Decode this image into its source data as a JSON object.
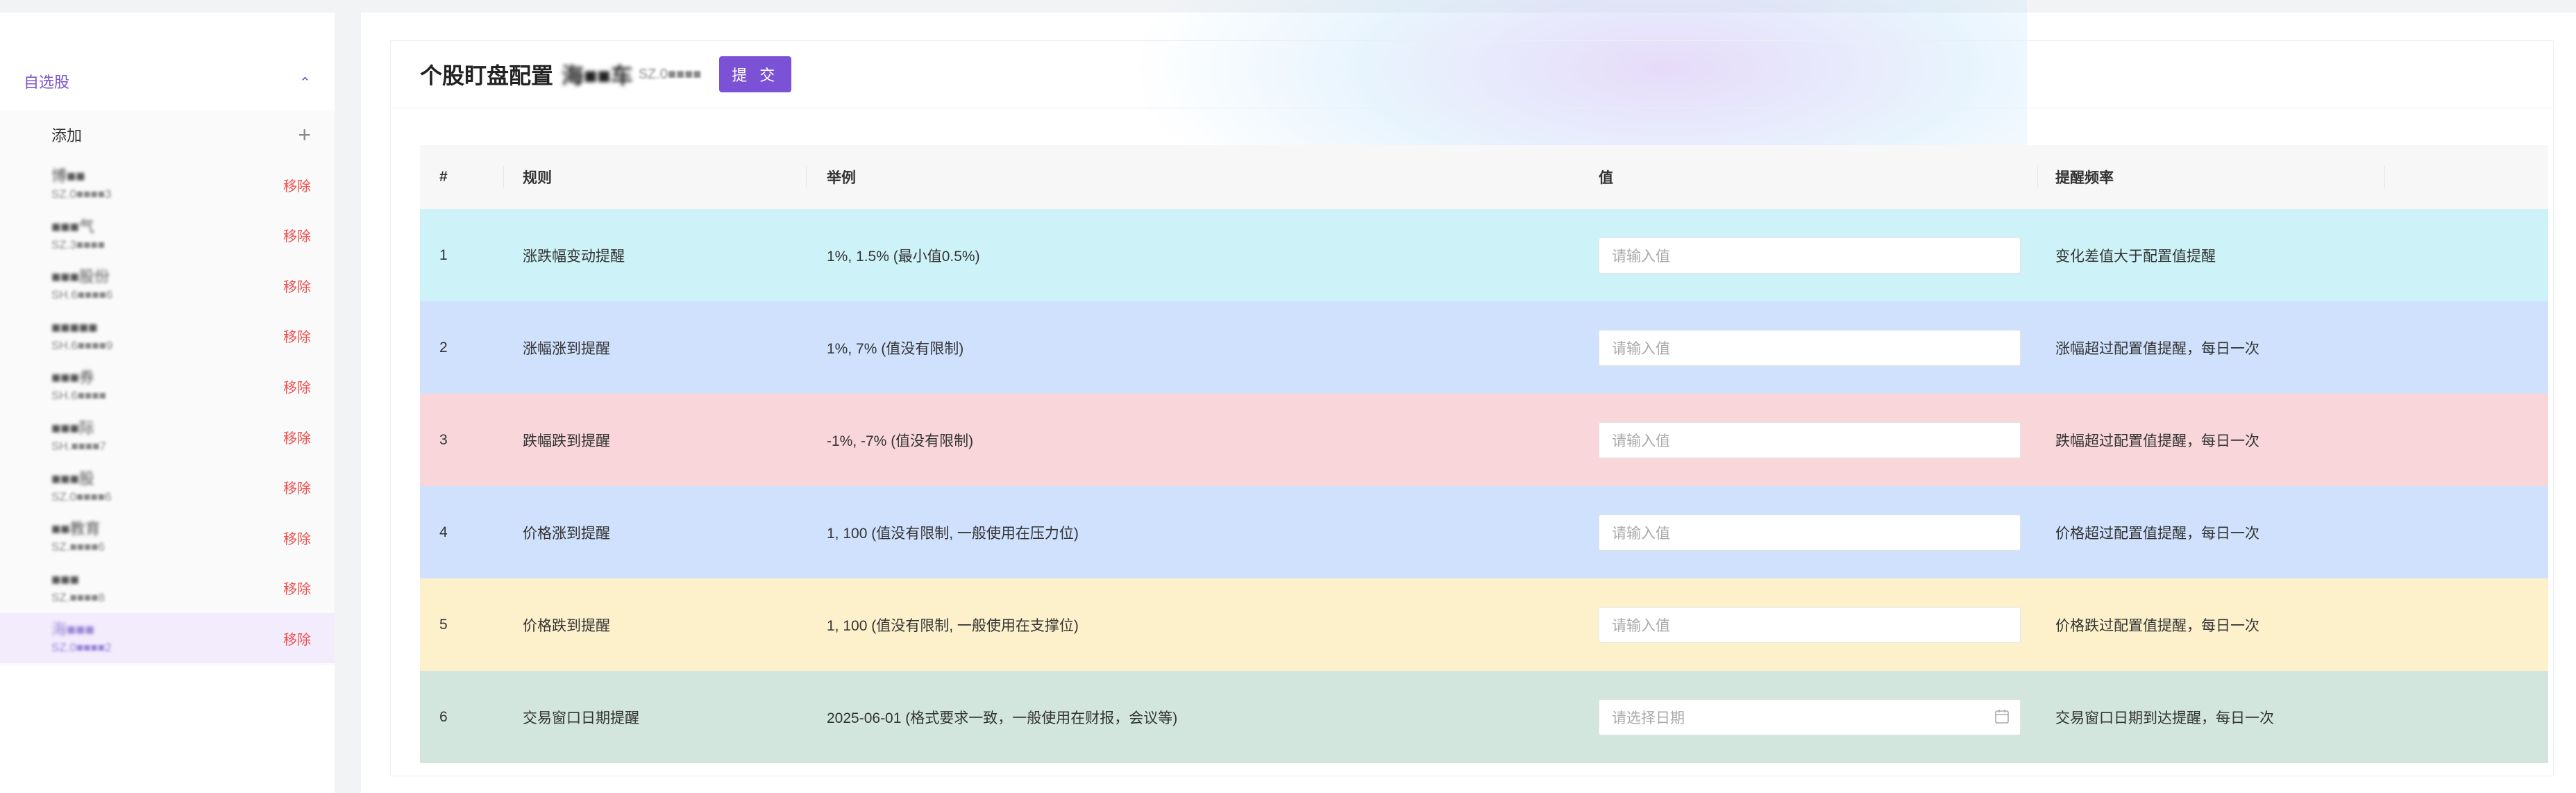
{
  "sidebar": {
    "group_title": "自选股",
    "add_label": "添加",
    "remove_label": "移除",
    "stocks": [
      {
        "name": "博■■",
        "code": "SZ.0■■■■3"
      },
      {
        "name": "■■■气",
        "code": "SZ.3■■■■"
      },
      {
        "name": "■■■股份",
        "code": "SH.6■■■■6"
      },
      {
        "name": "■■■■■",
        "code": "SH.6■■■■9"
      },
      {
        "name": "■■■券",
        "code": "SH.6■■■■"
      },
      {
        "name": "■■■际",
        "code": "SH.■■■■7"
      },
      {
        "name": "■■■股",
        "code": "SZ.0■■■■6"
      },
      {
        "name": "■■教育",
        "code": "SZ.■■■■6"
      },
      {
        "name": "■■■",
        "code": "SZ.■■■■8"
      },
      {
        "name": "海■■■",
        "code": "SZ.0■■■■2"
      }
    ]
  },
  "main": {
    "title": "个股盯盘配置",
    "selected_name": "海■■车",
    "selected_code": "SZ.0■■■■",
    "submit_label": "提 交",
    "columns": [
      "#",
      "规则",
      "举例",
      "值",
      "提醒频率"
    ],
    "rows": [
      {
        "no": "1",
        "rule": "涨跌幅变动提醒",
        "example": "1%, 1.5% (最小值0.5%)",
        "placeholder": "请输入值",
        "freq": "变化差值大于配置值提醒",
        "bg": "#cdf3f8"
      },
      {
        "no": "2",
        "rule": "涨幅涨到提醒",
        "example": "1%, 7% (值没有限制)",
        "placeholder": "请输入值",
        "freq": "涨幅超过配置值提醒，每日一次",
        "bg": "#cfe1fc"
      },
      {
        "no": "3",
        "rule": "跌幅跌到提醒",
        "example": "-1%, -7% (值没有限制)",
        "placeholder": "请输入值",
        "freq": "跌幅超过配置值提醒，每日一次",
        "bg": "#f8d6da"
      },
      {
        "no": "4",
        "rule": "价格涨到提醒",
        "example": "1, 100 (值没有限制, 一般使用在压力位)",
        "placeholder": "请输入值",
        "freq": "价格超过配置值提醒，每日一次",
        "bg": "#cfe1fc"
      },
      {
        "no": "5",
        "rule": "价格跌到提醒",
        "example": "1, 100 (值没有限制, 一般使用在支撑位)",
        "placeholder": "请输入值",
        "freq": "价格跌过配置值提醒，每日一次",
        "bg": "#fdf1cc"
      },
      {
        "no": "6",
        "rule": "交易窗口日期提醒",
        "example": "2025-06-01 (格式要求一致，一般使用在财报，会议等)",
        "placeholder": "请选择日期",
        "freq": "交易窗口日期到达提醒，每日一次",
        "bg": "#d2e6de"
      }
    ]
  }
}
